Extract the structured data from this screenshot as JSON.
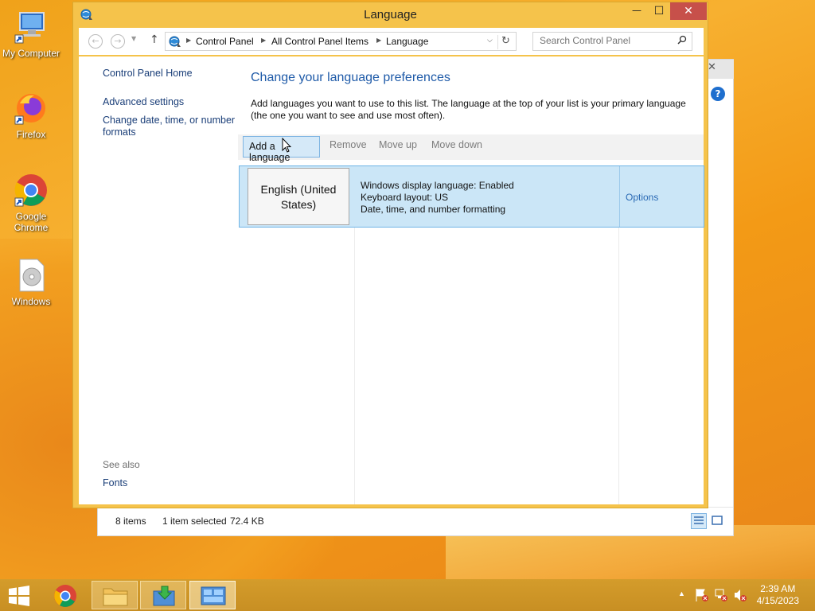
{
  "desktop": {
    "icons": [
      {
        "label": "My Computer",
        "icon": "computer-icon"
      },
      {
        "label": "Firefox",
        "icon": "firefox-icon"
      },
      {
        "label": "Google Chrome",
        "icon": "chrome-icon"
      },
      {
        "label": "Windows",
        "icon": "disc-icon"
      }
    ]
  },
  "window": {
    "title": "Language",
    "buttons": {
      "minimize": "—",
      "maximize": "☐",
      "close": "✕"
    }
  },
  "address": {
    "crumbs": [
      "Control Panel",
      "All Control Panel Items",
      "Language"
    ],
    "search_placeholder": "Search Control Panel"
  },
  "sidebar": {
    "links": [
      "Control Panel Home",
      "Advanced settings",
      "Change date, time, or number formats"
    ],
    "see_also_label": "See also",
    "see_also_links": [
      "Fonts"
    ]
  },
  "main": {
    "heading": "Change your language preferences",
    "description": "Add languages you want to use to this list. The language at the top of your list is your primary language (the one you want to see and use most often).",
    "toolbar": [
      "Add a language",
      "Remove",
      "Move up",
      "Move down"
    ]
  },
  "languages": [
    {
      "name": "English (United States)",
      "details": [
        "Windows display language: Enabled",
        "Keyboard layout: US",
        "Date, time, and number formatting"
      ],
      "action": "Options"
    }
  ],
  "background_window": {
    "status": {
      "items": "8 items",
      "selected": "1 item selected",
      "size": "72.4 KB"
    }
  },
  "taskbar": {
    "clock_time": "2:39 AM",
    "clock_date": "4/15/2023"
  },
  "colors": {
    "window_frame": "#f5c34b",
    "close_button": "#c7504a",
    "selection": "#cbe6f7",
    "link": "#1a3e78",
    "heading": "#1e5aa8"
  }
}
